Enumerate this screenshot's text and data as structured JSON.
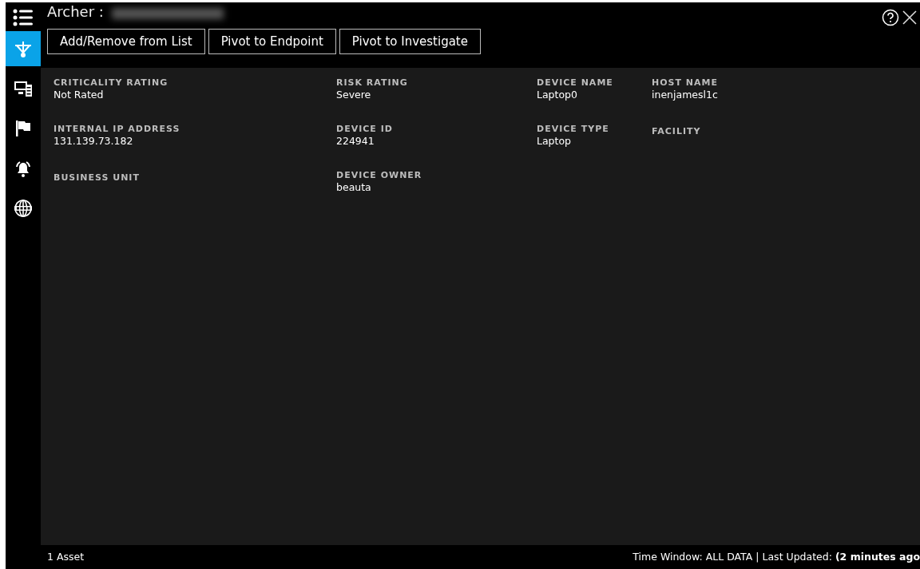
{
  "window": {
    "title": "Archer :",
    "title_blurred": true
  },
  "sidebar": {
    "items": [
      {
        "kind": "target",
        "selected": true
      },
      {
        "kind": "computer",
        "selected": false
      },
      {
        "kind": "flag",
        "selected": false
      },
      {
        "kind": "alarm",
        "selected": false
      },
      {
        "kind": "globe",
        "selected": false
      }
    ]
  },
  "toolbar": {
    "buttons": [
      "Add/Remove from List",
      "Pivot to Endpoint",
      "Pivot to Investigate"
    ]
  },
  "details": {
    "rows": [
      [
        {
          "label": "CRITICALITY RATING",
          "value": "Not Rated"
        },
        {
          "label": "RISK RATING",
          "value": "Severe"
        },
        {
          "label": "DEVICE NAME",
          "value": "Laptop0"
        },
        {
          "label": "HOST NAME",
          "value": "inenjamesl1c"
        }
      ],
      [
        {
          "label": "INTERNAL IP ADDRESS",
          "value": "131.139.73.182"
        },
        {
          "label": "DEVICE ID",
          "value": "224941"
        },
        {
          "label": "DEVICE TYPE",
          "value": "Laptop"
        },
        {
          "label": "FACILITY"
        }
      ],
      [
        {
          "label": "BUSINESS UNIT"
        },
        {
          "label": "DEVICE OWNER",
          "value": "beauta"
        }
      ]
    ]
  },
  "status_bar": {
    "count": "1 Asset",
    "time_window": "Time Window: ALL DATA | Last Updated:",
    "updated": "(2 minutes ago"
  }
}
